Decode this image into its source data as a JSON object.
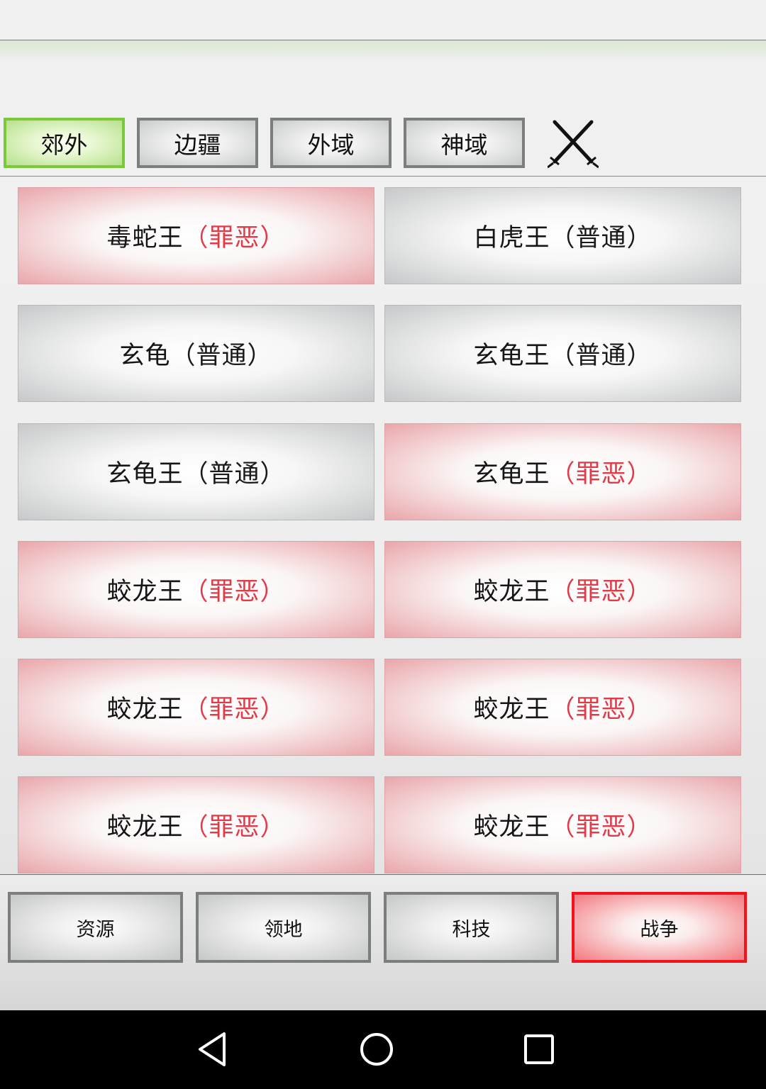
{
  "tabs": [
    {
      "label": "郊外",
      "active": true
    },
    {
      "label": "边疆",
      "active": false
    },
    {
      "label": "外域",
      "active": false
    },
    {
      "label": "神域",
      "active": false
    }
  ],
  "targets": [
    {
      "name": "毒蛇王",
      "tag": "（罪恶）",
      "type": "evil"
    },
    {
      "name": "白虎王",
      "tag": "（普通）",
      "type": "normal"
    },
    {
      "name": "玄龟",
      "tag": "（普通）",
      "type": "normal"
    },
    {
      "name": "玄龟王",
      "tag": "（普通）",
      "type": "normal"
    },
    {
      "name": "玄龟王",
      "tag": "（普通）",
      "type": "normal"
    },
    {
      "name": "玄龟王",
      "tag": "（罪恶）",
      "type": "evil"
    },
    {
      "name": "蛟龙王",
      "tag": "（罪恶）",
      "type": "evil"
    },
    {
      "name": "蛟龙王",
      "tag": "（罪恶）",
      "type": "evil"
    },
    {
      "name": "蛟龙王",
      "tag": "（罪恶）",
      "type": "evil"
    },
    {
      "name": "蛟龙王",
      "tag": "（罪恶）",
      "type": "evil"
    },
    {
      "name": "蛟龙王",
      "tag": "（罪恶）",
      "type": "evil"
    },
    {
      "name": "蛟龙王",
      "tag": "（罪恶）",
      "type": "evil"
    }
  ],
  "bottom_nav": [
    {
      "label": "资源",
      "active": false
    },
    {
      "label": "领地",
      "active": false
    },
    {
      "label": "科技",
      "active": false
    },
    {
      "label": "战争",
      "active": true
    }
  ],
  "icons": {
    "close": "crossed-swords-icon",
    "nav_back": "back-triangle-icon",
    "nav_home": "home-circle-icon",
    "nav_recent": "recent-square-icon"
  },
  "colors": {
    "active_tab_border": "#79c93a",
    "evil_tag": "#e23a47",
    "war_active_border": "#f0141c"
  }
}
